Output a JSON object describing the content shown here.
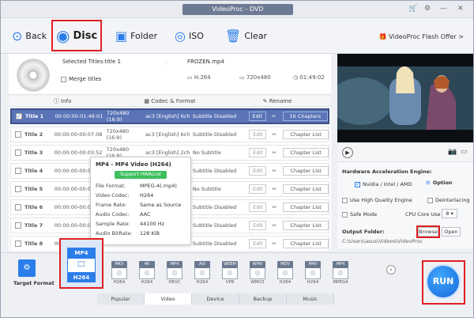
{
  "window": {
    "title": "VideoProc - DVD"
  },
  "toolbar": {
    "back": "Back",
    "disc": "Disc",
    "folder": "Folder",
    "iso": "ISO",
    "clear": "Clear",
    "flash_offer": "VideoProc Flash Offer >"
  },
  "source": {
    "selected_titles": "Selected Titles:title 1",
    "merge_titles": "Merge titles",
    "output_file": "FROZEN.mp4",
    "codec": "H.264",
    "resolution": "720x480",
    "duration": "01:49:02"
  },
  "info_tabs": {
    "info": "Info",
    "codec_format": "Codec & Format",
    "rename": "Rename"
  },
  "titles": [
    {
      "name": "Title 1",
      "time": "00:00:00-01:49:01",
      "res": "720x480 (16:9)",
      "audio": "ac3 [English] 6ch",
      "subtitle": "Subtitle Disabled",
      "edit": "Edit",
      "chapters": "16 Chapters",
      "checked": true
    },
    {
      "name": "Title 2",
      "time": "00:00:00-00:07:08",
      "res": "720x480 (16:9)",
      "audio": "ac3 [English] 6ch",
      "subtitle": "Subtitle Disabled",
      "edit": "Edit",
      "chapters": "Chapter List",
      "checked": false
    },
    {
      "name": "Title 3",
      "time": "00:00:00-00:03:52",
      "res": "720x480 (16:9)",
      "audio": "ac3 [English] 2ch",
      "subtitle": "No Subtitle",
      "edit": "Edit",
      "chapters": "Chapter List",
      "checked": false
    },
    {
      "name": "Title 4",
      "time": "00:00:00-00:0",
      "res": "",
      "audio": "",
      "subtitle": "Subtitle Disabled",
      "edit": "Edit",
      "chapters": "Chapter List",
      "checked": false
    },
    {
      "name": "Title 5",
      "time": "00:00:00-00:0",
      "res": "",
      "audio": "",
      "subtitle": "No Subtitle",
      "edit": "Edit",
      "chapters": "Chapter List",
      "checked": false
    },
    {
      "name": "Title 6",
      "time": "00:00:00-00:04:1",
      "res": "",
      "audio": "",
      "subtitle": "Subtitle Disabled",
      "edit": "Edit",
      "chapters": "Chapter List",
      "checked": false
    },
    {
      "name": "Title 7",
      "time": "00:00:00-00:01:1",
      "res": "",
      "audio": "",
      "subtitle": "Subtitle Disabled",
      "edit": "Edit",
      "chapters": "Chapter List",
      "checked": false
    },
    {
      "name": "Title 8",
      "time": "00:00:00-00:03:",
      "res": "",
      "audio": "",
      "subtitle": "Subtitle Disabled",
      "edit": "Edit",
      "chapters": "Chapter List",
      "checked": false
    }
  ],
  "popup": {
    "header": "MP4 - MP4 Video (H264)",
    "hw_badge": "Support HWAccel",
    "rows": [
      {
        "k": "File Format:",
        "v": "MPEG-4(.mp4)"
      },
      {
        "k": "Video Codec:",
        "v": "H264"
      },
      {
        "k": "Frame Rate:",
        "v": "Same as Source"
      },
      {
        "k": "Audio Codec:",
        "v": "AAC"
      },
      {
        "k": "Sample Rate:",
        "v": "44100 Hz"
      },
      {
        "k": "Audio BitRate:",
        "v": "128 KiB"
      }
    ]
  },
  "hw": {
    "title": "Hardware Acceleration Engine:",
    "engine": "Nvidia / Intel / AMD",
    "option": "Option",
    "high_quality": "Use High Quality Engine",
    "deinterlacing": "Deinterlacing",
    "safe_mode": "Safe Mode",
    "cpu_core_use": "CPU Core Use",
    "cpu_value": "8"
  },
  "output": {
    "label": "Output Folder:",
    "path": "C:\\Users\\asus\\Videos\\VideoProc",
    "browse": "Browse",
    "open": "Open"
  },
  "target": {
    "label": "Target Format",
    "selected_top": "MP4",
    "selected_bottom": "H264",
    "formats": [
      {
        "tag": "MKV",
        "name": "H264"
      },
      {
        "tag": "4K",
        "name": "H264"
      },
      {
        "tag": "MP4",
        "name": "HEVC"
      },
      {
        "tag": "AVI",
        "name": "H264"
      },
      {
        "tag": "WEBM",
        "name": "VP8"
      },
      {
        "tag": "WMV",
        "name": "WMV2"
      },
      {
        "tag": "MOV",
        "name": "H264"
      },
      {
        "tag": "M4V",
        "name": "H264"
      },
      {
        "tag": "MP4",
        "name": "MPEG4"
      }
    ]
  },
  "bottom_tabs": [
    "Popular",
    "Video",
    "Device",
    "Backup",
    "Music"
  ],
  "run": "RUN"
}
